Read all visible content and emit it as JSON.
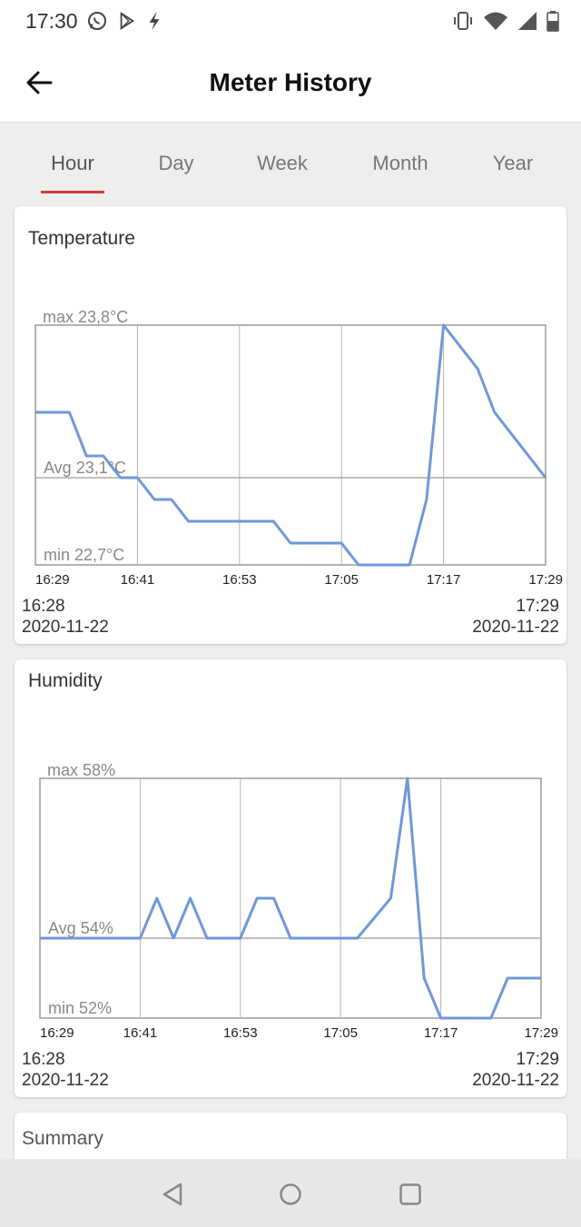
{
  "status_bar": {
    "time": "17:30",
    "left_icons": [
      "whatsapp-icon",
      "play-store-icon",
      "bolt-icon"
    ],
    "right_icons": [
      "vibrate-icon",
      "wifi-icon",
      "signal-icon",
      "battery-icon"
    ]
  },
  "app_bar": {
    "title": "Meter History",
    "back_icon": "arrow-left-icon"
  },
  "tabs": [
    {
      "label": "Hour",
      "active": true
    },
    {
      "label": "Day",
      "active": false
    },
    {
      "label": "Week",
      "active": false
    },
    {
      "label": "Month",
      "active": false
    },
    {
      "label": "Year",
      "active": false
    }
  ],
  "colors": {
    "accent": "#d23b3b",
    "line": "#6f97dc",
    "grid": "#9a9a9a",
    "axis_label": "#888888"
  },
  "temperature": {
    "title": "Temperature",
    "start_time": "16:28",
    "start_date": "2020-11-22",
    "end_time": "17:29",
    "end_date": "2020-11-22"
  },
  "humidity": {
    "title": "Humidity",
    "start_time": "16:28",
    "start_date": "2020-11-22",
    "end_time": "17:29",
    "end_date": "2020-11-22"
  },
  "summary": {
    "title": "Summary"
  },
  "chart_data": [
    {
      "type": "line",
      "title": "Temperature",
      "max_label": "max 23,8°C",
      "avg_label": "Avg 23,1°C",
      "min_label": "min 22,7°C",
      "ylim": [
        22.7,
        23.8
      ],
      "avg": 23.1,
      "x_ticks": [
        "16:29",
        "16:41",
        "16:53",
        "17:05",
        "17:17",
        "17:29"
      ],
      "x_range": [
        0,
        60
      ],
      "x": [
        0,
        4,
        6,
        8,
        10,
        12,
        14,
        16,
        18,
        28,
        30,
        36,
        38,
        44,
        46,
        48,
        52,
        54,
        60
      ],
      "values": [
        23.4,
        23.4,
        23.2,
        23.2,
        23.1,
        23.1,
        23.0,
        23.0,
        22.9,
        22.9,
        22.8,
        22.8,
        22.7,
        22.7,
        23.0,
        23.8,
        23.6,
        23.4,
        23.1
      ]
    },
    {
      "type": "line",
      "title": "Humidity",
      "max_label": "max 58%",
      "avg_label": "Avg 54%",
      "min_label": "min 52%",
      "ylim": [
        52,
        58
      ],
      "avg": 54,
      "x_ticks": [
        "16:29",
        "16:41",
        "16:53",
        "17:05",
        "17:17",
        "17:29"
      ],
      "x_range": [
        0,
        60
      ],
      "x": [
        0,
        12,
        14,
        16,
        18,
        20,
        24,
        26,
        28,
        30,
        38,
        42,
        44,
        46,
        48,
        50,
        54,
        56,
        60
      ],
      "values": [
        54,
        54,
        55,
        54,
        55,
        54,
        54,
        55,
        55,
        54,
        54,
        55,
        58,
        53,
        52,
        52,
        52,
        53,
        53
      ]
    }
  ]
}
